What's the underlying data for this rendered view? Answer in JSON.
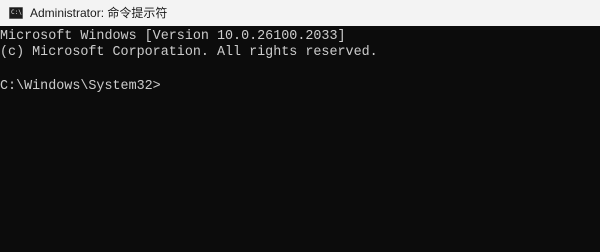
{
  "window": {
    "title": "Administrator: 命令提示符",
    "icon": "cmd-console-icon",
    "icon_glyph": "C:\\"
  },
  "console": {
    "lines": [
      "Microsoft Windows [Version 10.0.26100.2033]",
      "(c) Microsoft Corporation. All rights reserved.",
      "C:\\Windows\\System32>"
    ]
  },
  "colors": {
    "console_background": "#0c0c0c",
    "console_text": "#cccccc",
    "titlebar_background": "#f3f3f3"
  }
}
